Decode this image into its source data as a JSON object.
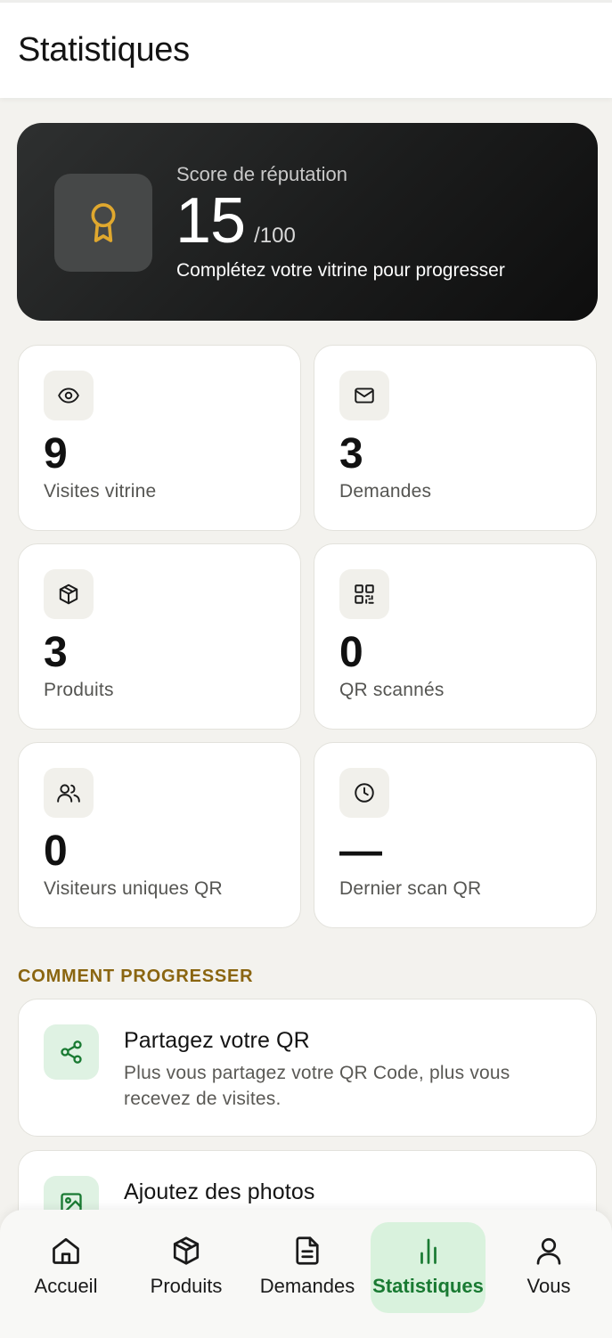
{
  "header": {
    "title": "Statistiques"
  },
  "reputation": {
    "label": "Score de réputation",
    "score": "15",
    "max": "/100",
    "hint": "Complétez votre vitrine pour progresser",
    "icon": "award-icon",
    "accent": "#e0a82e"
  },
  "stats": [
    {
      "icon": "eye-icon",
      "value": "9",
      "label": "Visites vitrine"
    },
    {
      "icon": "mail-icon",
      "value": "3",
      "label": "Demandes"
    },
    {
      "icon": "package-icon",
      "value": "3",
      "label": "Produits"
    },
    {
      "icon": "qr-code-icon",
      "value": "0",
      "label": "QR scannés"
    },
    {
      "icon": "users-icon",
      "value": "0",
      "label": "Visiteurs uniques QR"
    },
    {
      "icon": "clock-icon",
      "value": "—",
      "label": "Dernier scan QR"
    }
  ],
  "progress": {
    "title": "COMMENT PROGRESSER",
    "tips": [
      {
        "icon": "share-icon",
        "title": "Partagez votre QR",
        "description": "Plus vous partagez votre QR Code, plus vous recevez de visites."
      },
      {
        "icon": "image-icon",
        "title": "Ajoutez des photos"
      }
    ]
  },
  "nav": {
    "items": [
      {
        "icon": "home-icon",
        "label": "Accueil"
      },
      {
        "icon": "package-icon",
        "label": "Produits"
      },
      {
        "icon": "file-text-icon",
        "label": "Demandes"
      },
      {
        "icon": "bar-chart-icon",
        "label": "Statistiques",
        "active": true
      },
      {
        "icon": "user-icon",
        "label": "Vous"
      }
    ]
  },
  "colors": {
    "accent_green": "#197a32",
    "accent_green_bg": "#d9f2dd",
    "section_gold": "#8a6510",
    "background": "#f3f2ee"
  }
}
